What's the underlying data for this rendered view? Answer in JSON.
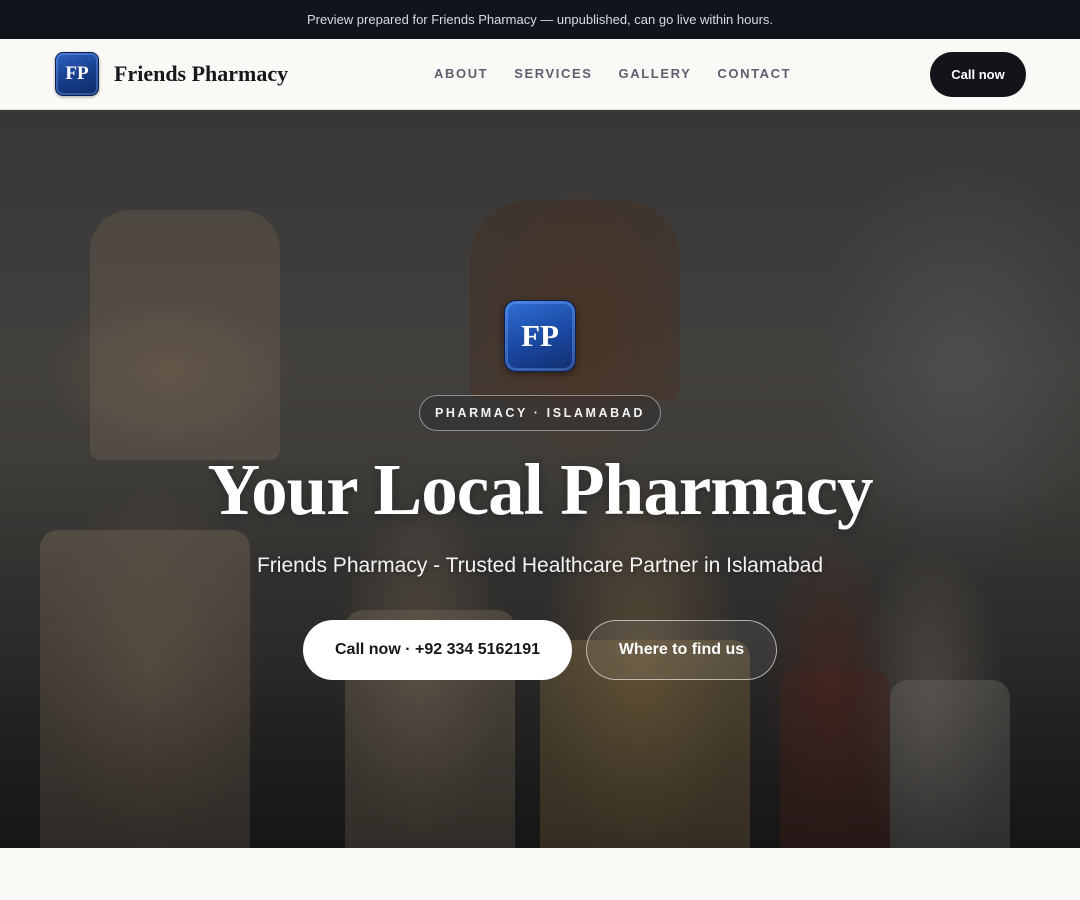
{
  "topbar": {
    "text": "Preview prepared for Friends Pharmacy — unpublished, can go live within hours."
  },
  "header": {
    "logo_text": "FP",
    "brand_name": "Friends Pharmacy",
    "nav": [
      {
        "label": "ABOUT"
      },
      {
        "label": "SERVICES"
      },
      {
        "label": "GALLERY"
      },
      {
        "label": "CONTACT"
      }
    ],
    "cta_label": "Call now"
  },
  "hero": {
    "logo_text": "FP",
    "badge": "PHARMACY · ISLAMABAD",
    "title": "Your Local Pharmacy",
    "subtitle": "Friends Pharmacy - Trusted Healthcare Partner in Islamabad",
    "primary_button": "Call now · +92 334 5162191",
    "secondary_button": "Where to find us"
  },
  "colors": {
    "topbar_bg": "#11141b",
    "dark_button": "#12141a",
    "logo_blue": "#1a47a0",
    "page_bg": "#faf9f6"
  }
}
